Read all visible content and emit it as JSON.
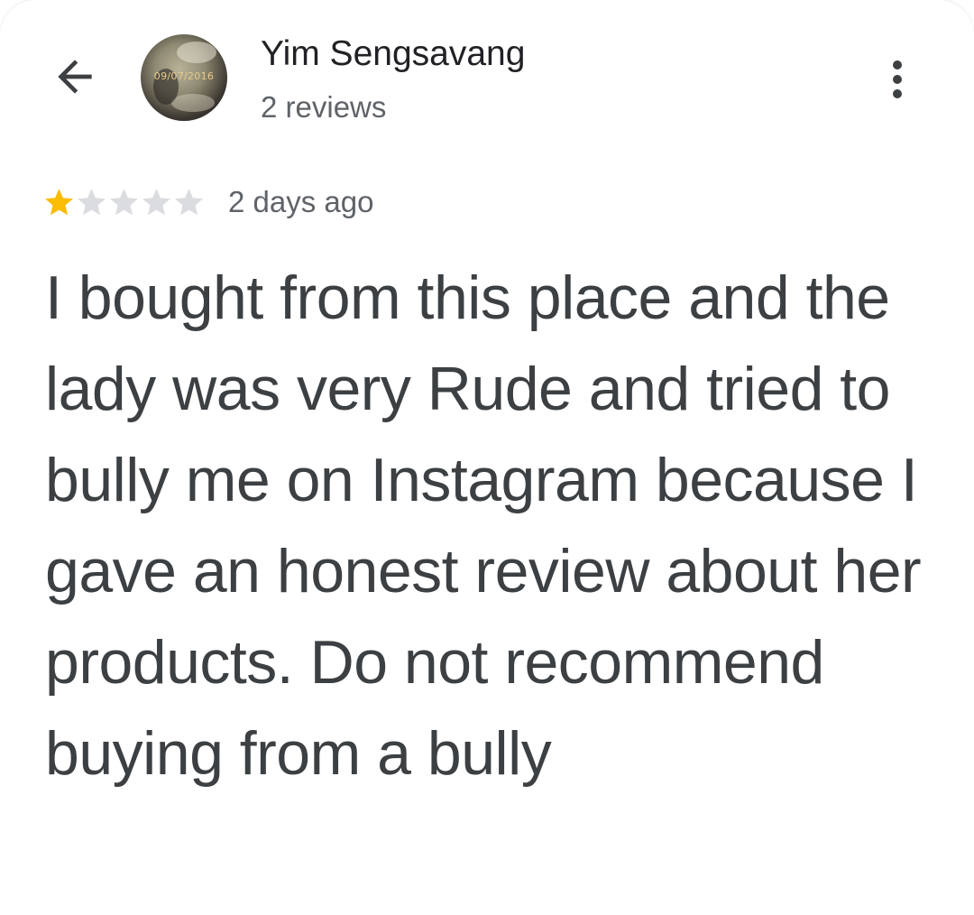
{
  "header": {
    "back_icon": "arrow-back-icon",
    "avatar_stamp": "09/07/2016",
    "author_name": "Yim Sengsavang",
    "author_meta": "2 reviews",
    "overflow_icon": "more-vert-icon"
  },
  "review": {
    "rating": 1,
    "rating_max": 5,
    "star_filled_color": "#fbbc04",
    "star_empty_color": "#dadce0",
    "date": "2 days ago",
    "text": "I bought from this place and the lady was very Rude and tried to bully me on Instagram because I gave an honest review about her products. Do not recommend buying from a bully"
  }
}
